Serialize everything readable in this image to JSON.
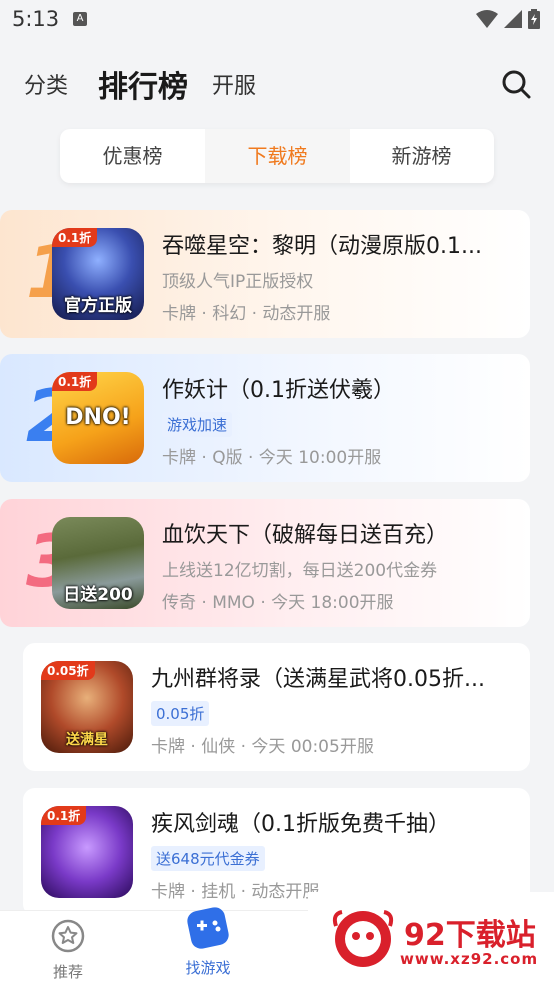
{
  "status": {
    "time": "5:13",
    "notice_letter": "A"
  },
  "topnav": {
    "tabs": [
      "分类",
      "排行榜",
      "开服"
    ]
  },
  "rank_tabs": [
    "优惠榜",
    "下载榜",
    "新游榜"
  ],
  "games": [
    {
      "rank": "1",
      "title": "吞噬星空：黎明（动漫原版0.1...",
      "desc": "顶级人气IP正版授权",
      "meta": "卡牌 · 科幻 · 动态开服",
      "badge": "0.1折",
      "caption": "官方正版"
    },
    {
      "rank": "2",
      "title": "作妖计（0.1折送伏羲）",
      "tag": "游戏加速",
      "meta": "卡牌 · Q版 · 今天 10:00开服",
      "badge": "0.1折",
      "caption": "DNO!"
    },
    {
      "rank": "3",
      "title": "血饮天下（破解每日送百充）",
      "desc": "上线送12亿切割，每日送200代金券",
      "meta": "传奇 · MMO · 今天 18:00开服",
      "badge": "",
      "caption": "日送200"
    },
    {
      "title": "九州群将录（送满星武将0.05折...",
      "tag": "0.05折",
      "meta": "卡牌 · 仙侠 · 今天 00:05开服",
      "badge": "0.05折",
      "caption": "送满星"
    },
    {
      "title": "疾风剑魂（0.1折版免费千抽）",
      "tag": "送648元代金券",
      "meta": "卡牌 · 挂机 · 动态开服",
      "badge": "0.1折",
      "caption": ""
    }
  ],
  "bottom_nav": [
    {
      "label": "推荐",
      "icon": "star-icon"
    },
    {
      "label": "找游戏",
      "icon": "gamepad-icon"
    }
  ],
  "watermark": {
    "text": "92下载站",
    "url": "www.xz92.com"
  },
  "colors": {
    "accent": "#f07a1e",
    "tag_blue": "#3b6fd4",
    "rank1": "#f5a04b",
    "rank2": "#3a7ff0",
    "rank3": "#f36b80"
  }
}
